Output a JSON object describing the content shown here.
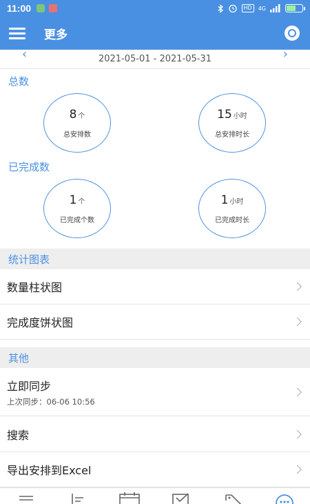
{
  "status_bar": {
    "time": "11:00",
    "network": "4G",
    "hd": "HD"
  },
  "header": {
    "title": "更多"
  },
  "date_range": {
    "text": "2021-05-01 - 2021-05-31"
  },
  "totals": {
    "title": "总数",
    "count": {
      "value": "8",
      "unit": "个",
      "label": "总安排数"
    },
    "hours": {
      "value": "15",
      "unit": "小时",
      "label": "总安排时长"
    }
  },
  "completed": {
    "title": "已完成数",
    "count": {
      "value": "1",
      "unit": "个",
      "label": "已完成个数"
    },
    "hours": {
      "value": "1",
      "unit": "小时",
      "label": "已完成时长"
    }
  },
  "charts_section": {
    "title": "统计图表",
    "items": [
      {
        "label": "数量柱状图"
      },
      {
        "label": "完成度饼状图"
      }
    ]
  },
  "other_section": {
    "title": "其他",
    "sync": {
      "label": "立即同步",
      "sub": "上次同步：06-06 10:56"
    },
    "search": {
      "label": "搜索"
    },
    "export": {
      "label": "导出安排到Excel"
    }
  },
  "bottom_tabs": [
    "list-icon",
    "agenda-icon",
    "calendar-icon",
    "checklist-icon",
    "tag-icon",
    "more-icon"
  ],
  "colors": {
    "accent": "#4a90e2",
    "section_bg": "#eeeeee"
  }
}
